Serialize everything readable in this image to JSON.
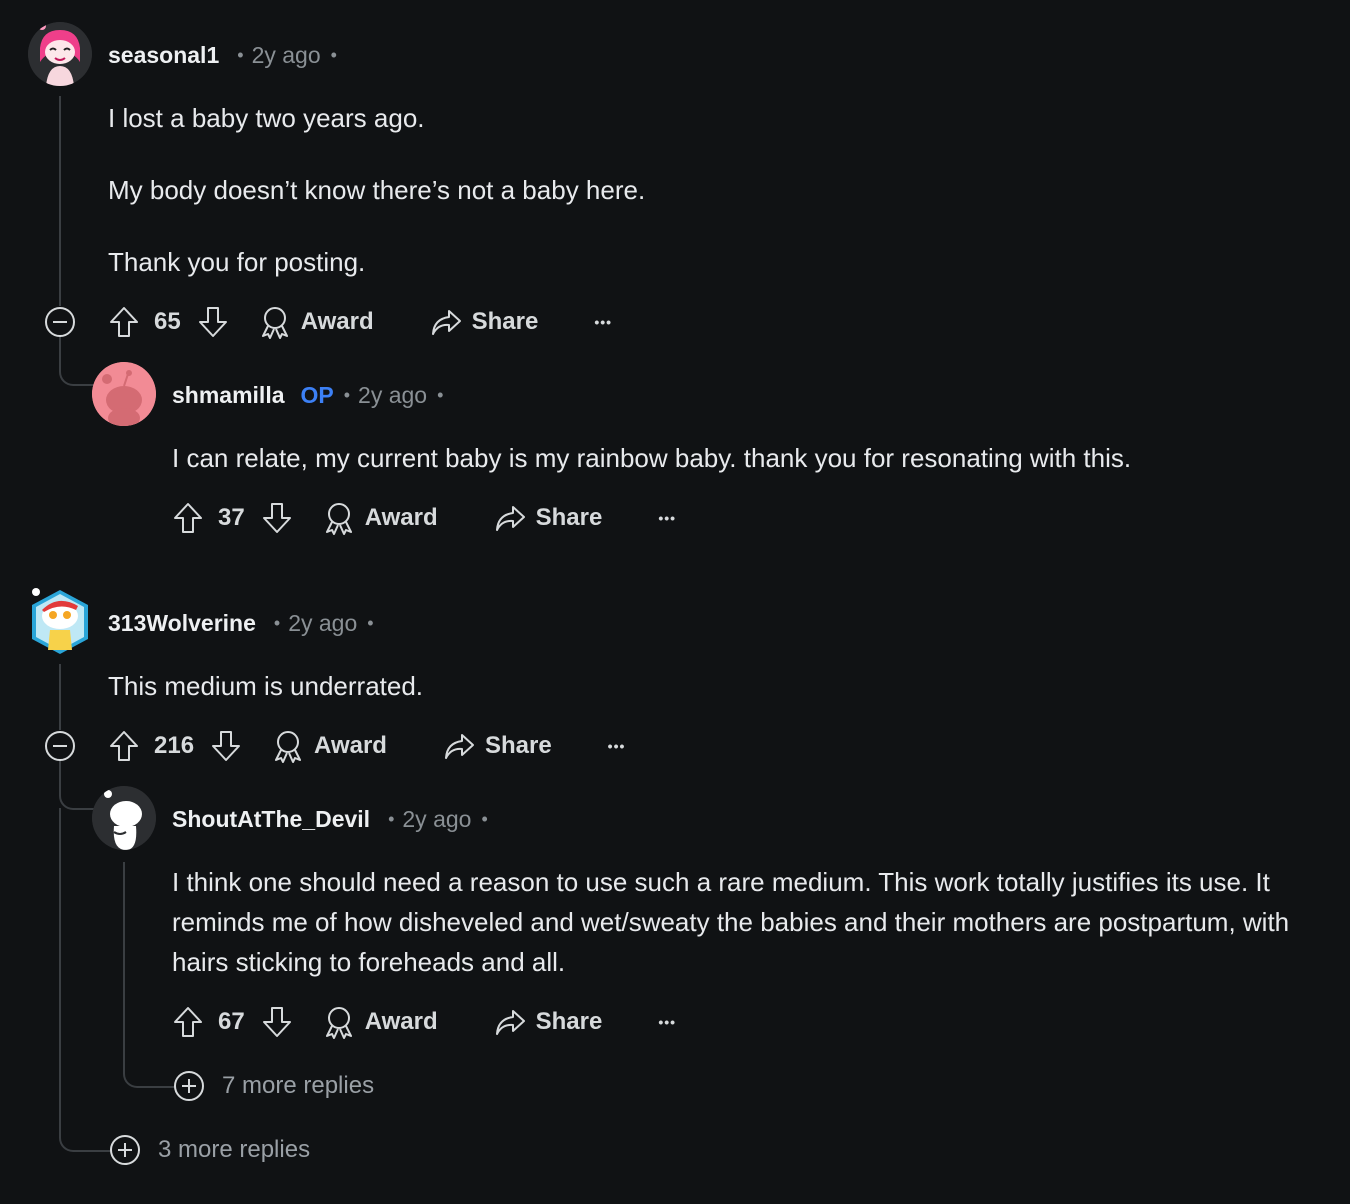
{
  "comments": [
    {
      "username": "seasonal1",
      "time": "2y ago",
      "paragraphs": [
        "I lost a baby two years ago.",
        "My body doesn’t know there’s not a baby here.",
        "Thank you for posting."
      ],
      "score": "65",
      "award_label": "Award",
      "share_label": "Share",
      "more_label": "•••"
    },
    {
      "username": "shmamilla",
      "badge": "OP",
      "time": "2y ago",
      "paragraphs": [
        "I can relate, my current baby is my rainbow baby. thank you for resonating with this."
      ],
      "score": "37",
      "award_label": "Award",
      "share_label": "Share",
      "more_label": "•••"
    },
    {
      "username": "313Wolverine",
      "time": "2y ago",
      "paragraphs": [
        "This medium is underrated."
      ],
      "score": "216",
      "award_label": "Award",
      "share_label": "Share",
      "more_label": "•••"
    },
    {
      "username": "ShoutAtThe_Devil",
      "time": "2y ago",
      "paragraphs": [
        "I think one should need a reason to use such a rare medium. This work totally justifies its use. It reminds me of how disheveled and wet/sweaty the babies and their mothers are postpartum, with hairs sticking to foreheads and all."
      ],
      "score": "67",
      "award_label": "Award",
      "share_label": "Share",
      "more_label": "•••"
    }
  ],
  "more_replies": {
    "nested": "7 more replies",
    "top": "3 more replies"
  },
  "separator": "•",
  "icons": [
    "upvote-icon",
    "downvote-icon",
    "award-icon",
    "share-icon",
    "more-icon",
    "collapse-icon",
    "expand-icon"
  ],
  "colors": {
    "background": "#101214",
    "op_badge": "#3c80f5",
    "muted": "#8a9095"
  }
}
